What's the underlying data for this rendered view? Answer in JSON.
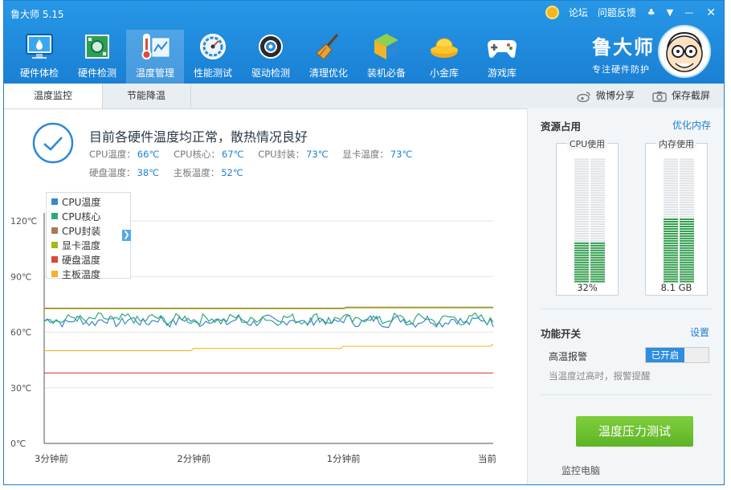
{
  "window": {
    "title": "鲁大师 5.15",
    "links": [
      "论坛",
      "问题反馈"
    ]
  },
  "nav": [
    {
      "label": "硬件体检",
      "icon": "monitor-icon"
    },
    {
      "label": "硬件检测",
      "icon": "circuit-board-icon"
    },
    {
      "label": "温度管理",
      "icon": "thermometer-icon"
    },
    {
      "label": "性能测试",
      "icon": "speedometer-icon"
    },
    {
      "label": "驱动检测",
      "icon": "gear-icon"
    },
    {
      "label": "清理优化",
      "icon": "broom-icon"
    },
    {
      "label": "装机必备",
      "icon": "cube-icon"
    },
    {
      "label": "小金库",
      "icon": "gold-ingot-icon"
    },
    {
      "label": "游戏库",
      "icon": "gamepad-icon"
    }
  ],
  "brand": {
    "name": "鲁大师",
    "slogan": "专注硬件防护"
  },
  "tabs": [
    "温度监控",
    "节能降温"
  ],
  "share": {
    "weibo": "微博分享",
    "screenshot": "保存截屏"
  },
  "status": {
    "title": "目前各硬件温度均正常，散热情况良好",
    "temps_row1": [
      {
        "label": "CPU温度：",
        "value": "66℃"
      },
      {
        "label": "CPU核心：",
        "value": "67℃"
      },
      {
        "label": "CPU封装：",
        "value": "73℃"
      },
      {
        "label": "显卡温度：",
        "value": "73℃"
      }
    ],
    "temps_row2": [
      {
        "label": "硬盘温度：",
        "value": "38℃"
      },
      {
        "label": "主板温度：",
        "value": "52℃"
      }
    ]
  },
  "chart_data": {
    "type": "line",
    "x_labels": [
      "3分钟前",
      "2分钟前",
      "1分钟前",
      "当前"
    ],
    "y_ticks": [
      "0℃",
      "30℃",
      "60℃",
      "90℃",
      "120℃"
    ],
    "ylim": [
      0,
      120
    ],
    "series": [
      {
        "name": "CPU温度",
        "color": "#3a86d0",
        "approx_value": 66,
        "noisy": true
      },
      {
        "name": "CPU核心",
        "color": "#2eaa76",
        "approx_value": 67,
        "noisy": true
      },
      {
        "name": "CPU封装",
        "color": "#a87a55",
        "approx_value": 73
      },
      {
        "name": "显卡温度",
        "color": "#a3b91e",
        "approx_value": 73
      },
      {
        "name": "硬盘温度",
        "color": "#d9463b",
        "approx_value": 38
      },
      {
        "name": "主板温度",
        "color": "#f0b429",
        "approx_value": 52
      }
    ]
  },
  "resources": {
    "title": "资源占用",
    "optimize": "优化内存",
    "cpu": {
      "label": "CPU使用",
      "value": "32%",
      "fraction": 0.32
    },
    "mem": {
      "label": "内存使用",
      "value": "8.1 GB",
      "fraction": 0.52
    }
  },
  "functions": {
    "title": "功能开关",
    "settings": "设置",
    "alarm_label": "高温报警",
    "alarm_state": "已开启",
    "alarm_desc": "当温度过高时，报警提醒"
  },
  "stress_button": "温度压力测试",
  "footer_text": "监控电脑"
}
